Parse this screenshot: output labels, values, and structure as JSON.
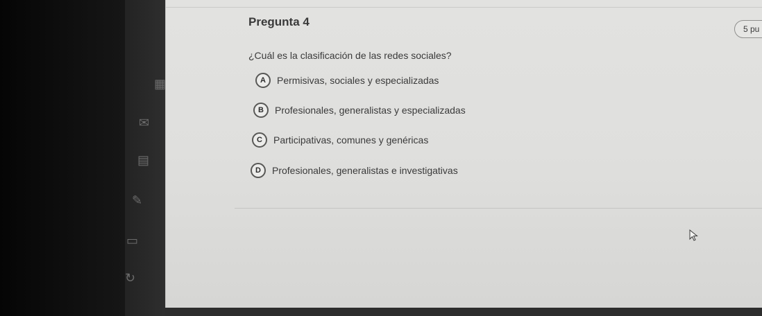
{
  "question_card": {
    "title": "Pregunta 4",
    "points": "5 pu",
    "prompt": "¿Cuál es la clasificación de las redes sociales?",
    "options": [
      {
        "letter": "A",
        "text": "Permisivas, sociales y especializadas"
      },
      {
        "letter": "B",
        "text": "Profesionales, generalistas y especializadas"
      },
      {
        "letter": "C",
        "text": "Participativas, comunes y genéricas"
      },
      {
        "letter": "D",
        "text": "Profesionales, generalistas e investigativas"
      }
    ]
  },
  "sidebar": {
    "icons": [
      "calendar-icon",
      "mail-icon",
      "document-icon",
      "edit-icon",
      "chat-icon",
      "refresh-icon"
    ]
  },
  "colors": {
    "panel_background": "#e0e0de",
    "text": "#3a3a3a",
    "option_circle_border": "#585856",
    "dark_background": "#0c0c0c"
  }
}
